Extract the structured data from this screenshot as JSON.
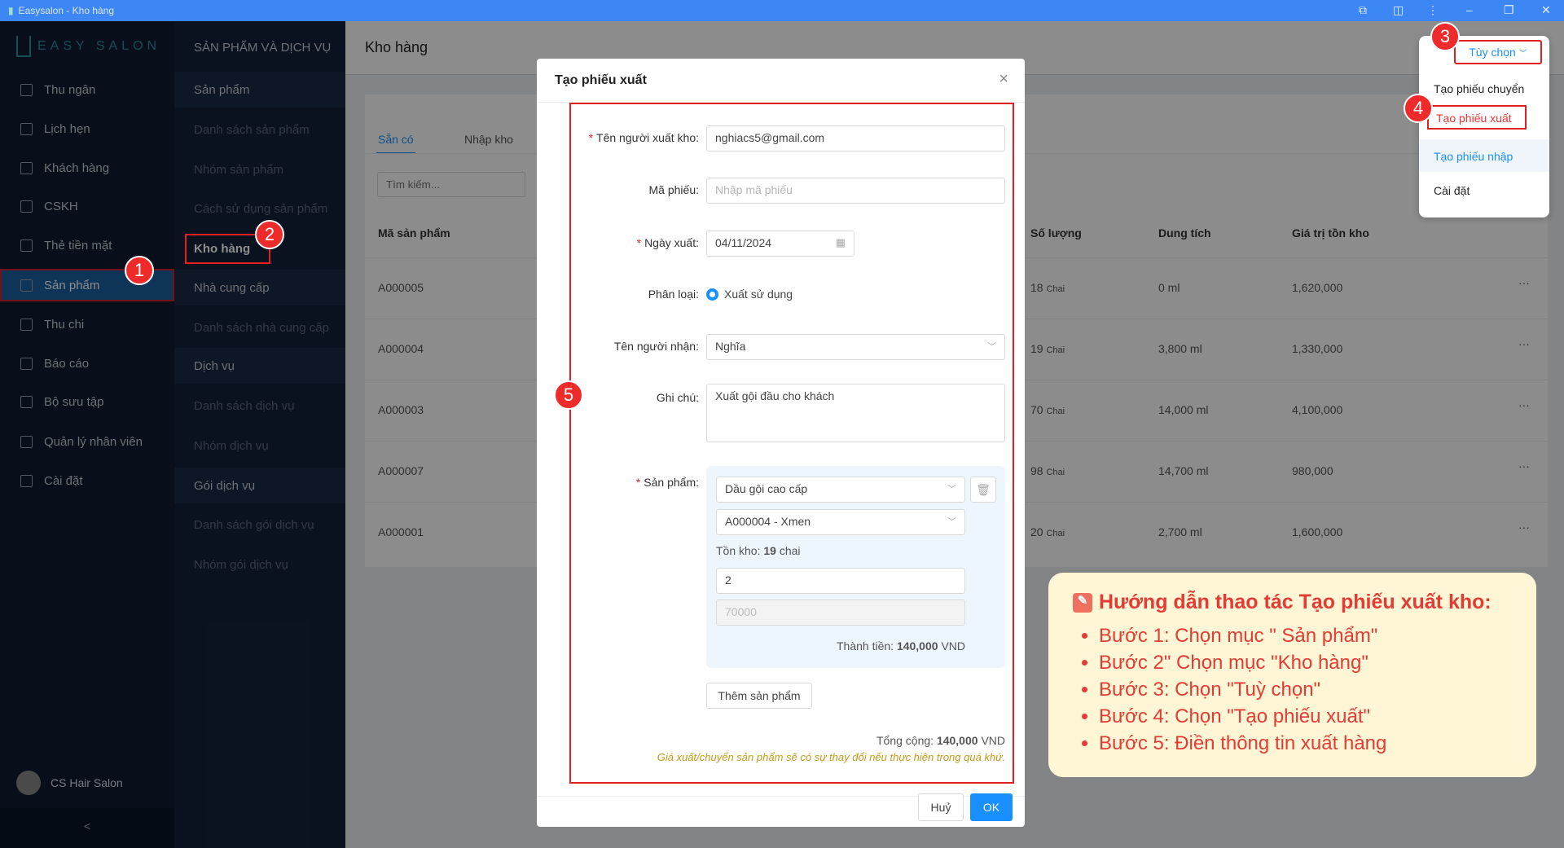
{
  "window": {
    "title": "Easysalon - Kho hàng"
  },
  "logo": "EASY SALON",
  "sidebar": {
    "items": [
      "Thu ngân",
      "Lịch hẹn",
      "Khách hàng",
      "CSKH",
      "Thẻ tiền mặt",
      "Sản phẩm",
      "Thu chi",
      "Báo cáo",
      "Bộ sưu tập",
      "Quản lý nhân viên",
      "Cài đặt"
    ],
    "active": "Sản phẩm",
    "user": "CS Hair Salon",
    "collapse": "<"
  },
  "subnav": {
    "title": "SẢN PHẨM VÀ DỊCH VỤ",
    "items": [
      {
        "label": "Sản phẩm",
        "group": true
      },
      {
        "label": "Danh sách sản phẩm"
      },
      {
        "label": "Nhóm sản phẩm"
      },
      {
        "label": "Cách sử dụng sản phẩm"
      },
      {
        "label": "Kho hàng",
        "selected": true
      },
      {
        "label": "Nhà cung cấp",
        "group": true
      },
      {
        "label": "Danh sách nhà cung cấp"
      },
      {
        "label": "Dịch vụ",
        "group": true
      },
      {
        "label": "Danh sách dịch vụ"
      },
      {
        "label": "Nhóm dịch vụ"
      },
      {
        "label": "Gói dịch vụ",
        "group": true
      },
      {
        "label": "Danh sách gói dịch vụ"
      },
      {
        "label": "Nhóm gói dịch vụ"
      }
    ]
  },
  "main": {
    "title": "Kho hàng",
    "tabs": [
      "Sẵn có",
      "Nhập kho"
    ],
    "search_placeholder": "Tìm kiếm...",
    "columns": [
      "Mã sản phẩm",
      "Số lượng",
      "Dung tích",
      "Giá trị tồn kho"
    ],
    "rows": [
      [
        "A000005",
        "18",
        "Chai",
        "0 ml",
        "1,620,000"
      ],
      [
        "A000004",
        "19",
        "Chai",
        "3,800 ml",
        "1,330,000"
      ],
      [
        "A000003",
        "70",
        "Chai",
        "14,000 ml",
        "4,100,000"
      ],
      [
        "A000007",
        "98",
        "Chai",
        "14,700 ml",
        "980,000"
      ],
      [
        "A000001",
        "20",
        "Chai",
        "2,700 ml",
        "1,600,000"
      ]
    ],
    "row_menu": "···"
  },
  "options": {
    "button": "Tùy chọn",
    "items": [
      "Tạo phiếu chuyển",
      "Tạo phiếu xuất",
      "Tạo phiếu nhập",
      "Cài đặt"
    ]
  },
  "modal": {
    "title": "Tạo phiếu xuất",
    "close": "×",
    "exporter_label": "Tên người xuất kho:",
    "exporter": "nghiacs5@gmail.com",
    "code_label": "Mã phiếu:",
    "code_placeholder": "Nhập mã phiếu",
    "date_label": "Ngày xuất:",
    "date": "04/11/2024",
    "type_label": "Phân loại:",
    "type": "Xuất sử dụng",
    "receiver_label": "Tên người nhận:",
    "receiver": "Nghĩa",
    "note_label": "Ghi chú:",
    "note": "Xuất gội đầu cho khách",
    "product_label": "Sản phẩm:",
    "product_group": "Dầu gội cao cấp",
    "product": "A000004 - Xmen",
    "stock_label": "Tồn kho:",
    "stock": "19",
    "stock_unit": "chai",
    "quantity": "2",
    "price": "70000",
    "subtotal_label": "Thành tiền:",
    "subtotal": "140,000",
    "currency": "VND",
    "add_product": "Thêm sản phẩm",
    "total_label": "Tổng cộng:",
    "total": "140,000",
    "warning": "Giá xuất/chuyển sản phẩm sẽ có sự thay đổi nếu thực hiện trong quá khứ.",
    "cancel": "Huỷ",
    "ok": "OK"
  },
  "badges": [
    "1",
    "2",
    "3",
    "4",
    "5"
  ],
  "guide": {
    "title": "Hướng dẫn thao tác Tạo phiếu xuất kho:",
    "steps": [
      "Bước 1: Chọn mục \" Sản phẩm\"",
      "Bước 2\" Chọn mục \"Kho hàng\"",
      "Bước 3: Chọn \"Tuỳ chọn\"",
      "Bước 4: Chọn \"Tạo phiếu xuất\"",
      "Bước 5: Điền thông tin xuất hàng"
    ]
  },
  "colors": {
    "accent": "#1890ff",
    "annotation": "#e02020",
    "titlebar": "#3d87f5",
    "guide_bg": "#fff6d5"
  }
}
